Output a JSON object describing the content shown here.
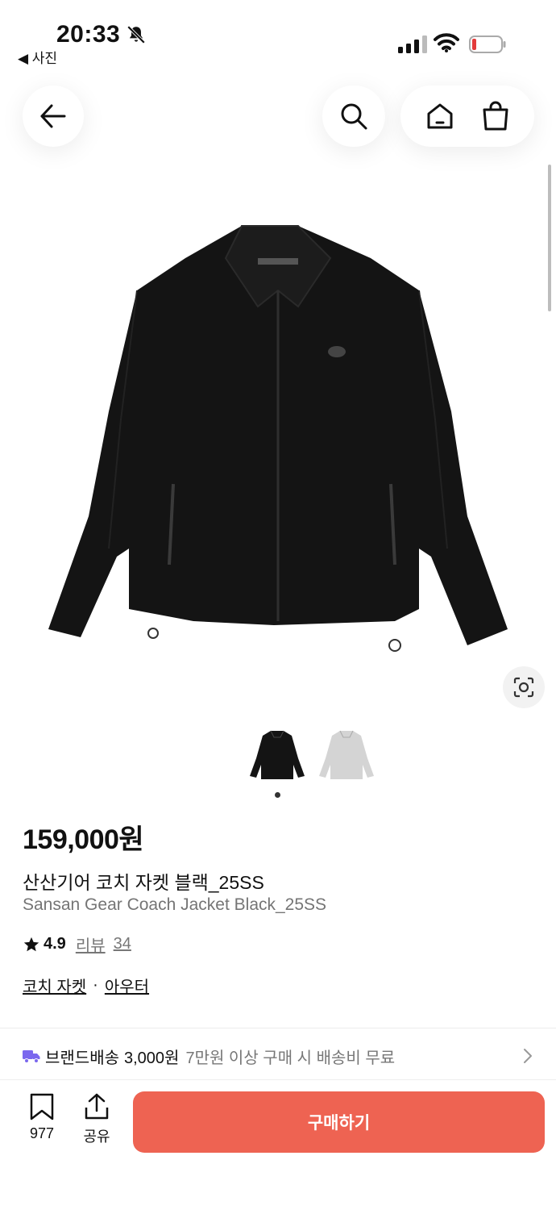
{
  "status": {
    "time": "20:33",
    "back_app": "◀ 사진",
    "battery_color": "#e33b3b"
  },
  "header": {
    "back_icon": "arrow-left-icon",
    "search_icon": "search-icon",
    "home_icon": "home-icon",
    "cart_icon": "shopping-bag-icon"
  },
  "gallery": {
    "image_count": 2,
    "active_index": 0,
    "thumbnails": [
      "black-jacket",
      "gray-jacket"
    ]
  },
  "product": {
    "price": "159,000원",
    "name_ko": "산산기어 코치 자켓 블랙_25SS",
    "name_en": "Sansan Gear Coach Jacket Black_25SS",
    "rating": "4.9",
    "review_label": "리뷰",
    "review_count": "34",
    "categories": [
      "코치 자켓",
      "아우터"
    ],
    "category_sep": "·"
  },
  "shipping": {
    "label": "브랜드배송",
    "fee": "3,000원",
    "note": "7만원 이상 구매 시 배송비 무료",
    "truck_color": "#7b68ee"
  },
  "bottom_bar": {
    "bookmark_count": "977",
    "share_label": "공유",
    "buy_label": "구매하기",
    "buy_color": "#ee6352"
  }
}
